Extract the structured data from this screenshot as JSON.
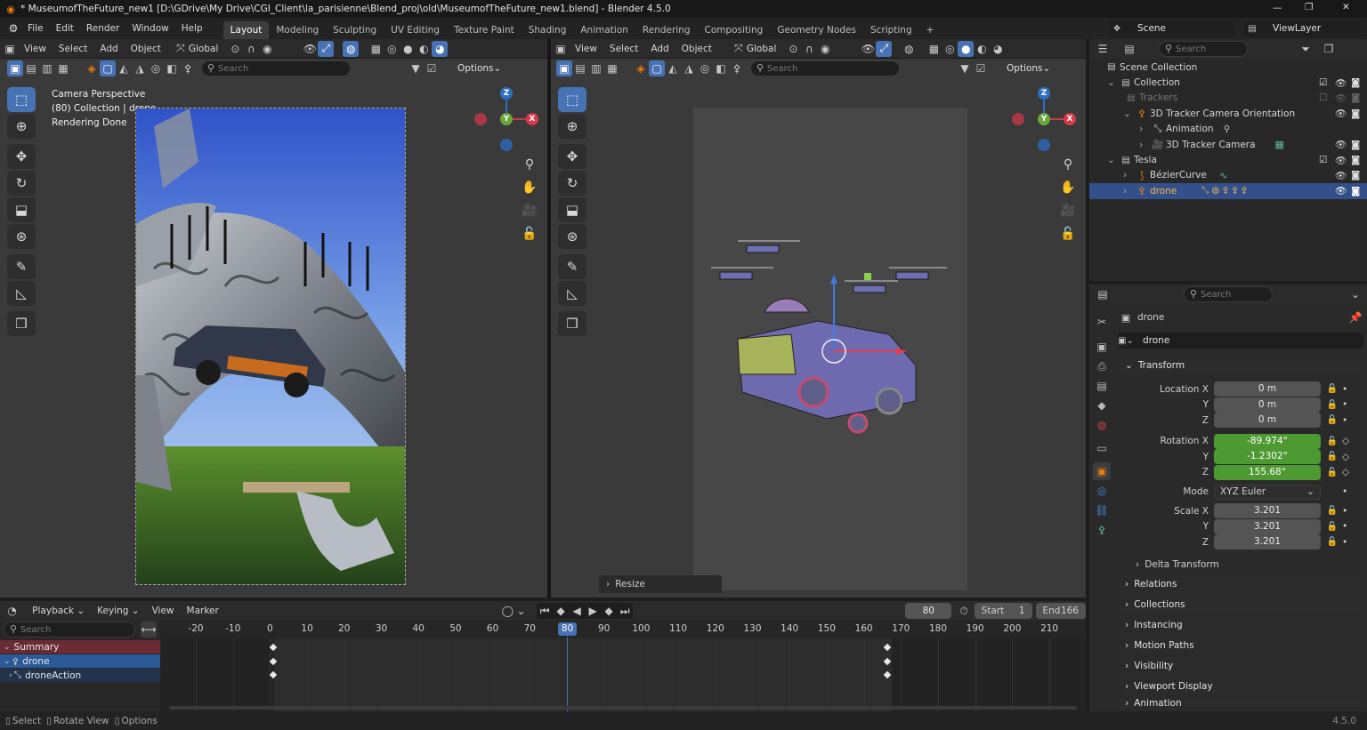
{
  "window": {
    "title": "* MuseumofTheFuture_new1 [D:\\GDrive\\My Drive\\CGI_Client\\la_parisienne\\Blend_proj\\old\\MuseumofTheFuture_new1.blend] - Blender 4.5.0",
    "minimize": "—",
    "maximize": "❐",
    "close": "✕"
  },
  "menu": [
    "File",
    "Edit",
    "Render",
    "Window",
    "Help"
  ],
  "workspaces": [
    "Layout",
    "Modeling",
    "Sculpting",
    "UV Editing",
    "Texture Paint",
    "Shading",
    "Animation",
    "Rendering",
    "Compositing",
    "Geometry Nodes",
    "Scripting"
  ],
  "workspace_add": "+",
  "scene": {
    "label": "Scene",
    "view_layer": "ViewLayer"
  },
  "viewport_left": {
    "menus": [
      "View",
      "Select",
      "Add",
      "Object"
    ],
    "orientation": "Global",
    "search_placeholder": "Search",
    "options": "Options",
    "overlay_lines": [
      "Camera Perspective",
      "(80) Collection | drone",
      "Rendering Done"
    ]
  },
  "viewport_right": {
    "menus": [
      "View",
      "Select",
      "Add",
      "Object"
    ],
    "orientation": "Global",
    "search_placeholder": "Search",
    "options": "Options",
    "resize_panel": "Resize"
  },
  "gizmo": {
    "z": "Z",
    "y": "Y",
    "x": "X"
  },
  "outliner": {
    "search_placeholder": "Search",
    "rows": [
      {
        "label": "Scene Collection",
        "indent": 0,
        "icon": "collection-icon"
      },
      {
        "label": "Collection",
        "indent": 1,
        "icon": "collection-icon"
      },
      {
        "label": "Trackers",
        "indent": 2,
        "icon": "collection-icon"
      },
      {
        "label": "3D Tracker Camera Orientation",
        "indent": 2,
        "icon": "empty-icon"
      },
      {
        "label": "Animation",
        "indent": 3,
        "icon": "action-icon"
      },
      {
        "label": "3D Tracker Camera",
        "indent": 3,
        "icon": "camera-icon"
      },
      {
        "label": "Tesla",
        "indent": 1,
        "icon": "collection-icon"
      },
      {
        "label": "BézierCurve",
        "indent": 2,
        "icon": "curve-icon"
      },
      {
        "label": "drone",
        "indent": 2,
        "icon": "armature-icon",
        "selected": true
      }
    ]
  },
  "properties": {
    "search_placeholder": "Search",
    "object_name": "drone",
    "datablock_name": "drone",
    "transform_label": "Transform",
    "location": {
      "label": "Location X",
      "x": "0 m",
      "y": "0 m",
      "z": "0 m"
    },
    "rotation": {
      "label": "Rotation X",
      "x": "-89.974°",
      "y": "-1.2302°",
      "z": "155.68°"
    },
    "axis_y": "Y",
    "axis_z": "Z",
    "mode": {
      "label": "Mode",
      "value": "XYZ Euler"
    },
    "scale": {
      "label": "Scale X",
      "x": "3.201",
      "y": "3.201",
      "z": "3.201"
    },
    "panels": [
      "Delta Transform",
      "Relations",
      "Collections",
      "Instancing",
      "Motion Paths",
      "Visibility",
      "Viewport Display",
      "Animation"
    ]
  },
  "timeline": {
    "menus": [
      "Playback",
      "Keying",
      "View",
      "Marker"
    ],
    "current_frame": "80",
    "start_label": "Start",
    "start": "1",
    "end_label": "End",
    "end": "166",
    "search_placeholder": "Search",
    "ticks": [
      "-20",
      "-10",
      "0",
      "10",
      "20",
      "30",
      "40",
      "50",
      "60",
      "70",
      "80",
      "90",
      "100",
      "110",
      "120",
      "130",
      "140",
      "150",
      "160",
      "170",
      "180",
      "190",
      "200",
      "210"
    ],
    "channels": [
      {
        "label": "Summary"
      },
      {
        "label": "drone"
      },
      {
        "label": "droneAction"
      }
    ]
  },
  "statusbar": {
    "items": [
      "Select",
      "Rotate View",
      "Options"
    ],
    "version": "4.5.0"
  },
  "colors": {
    "accent": "#4772b3",
    "selection": "#33508a",
    "animated": "#4e9a32",
    "summary": "#6b2b33"
  }
}
